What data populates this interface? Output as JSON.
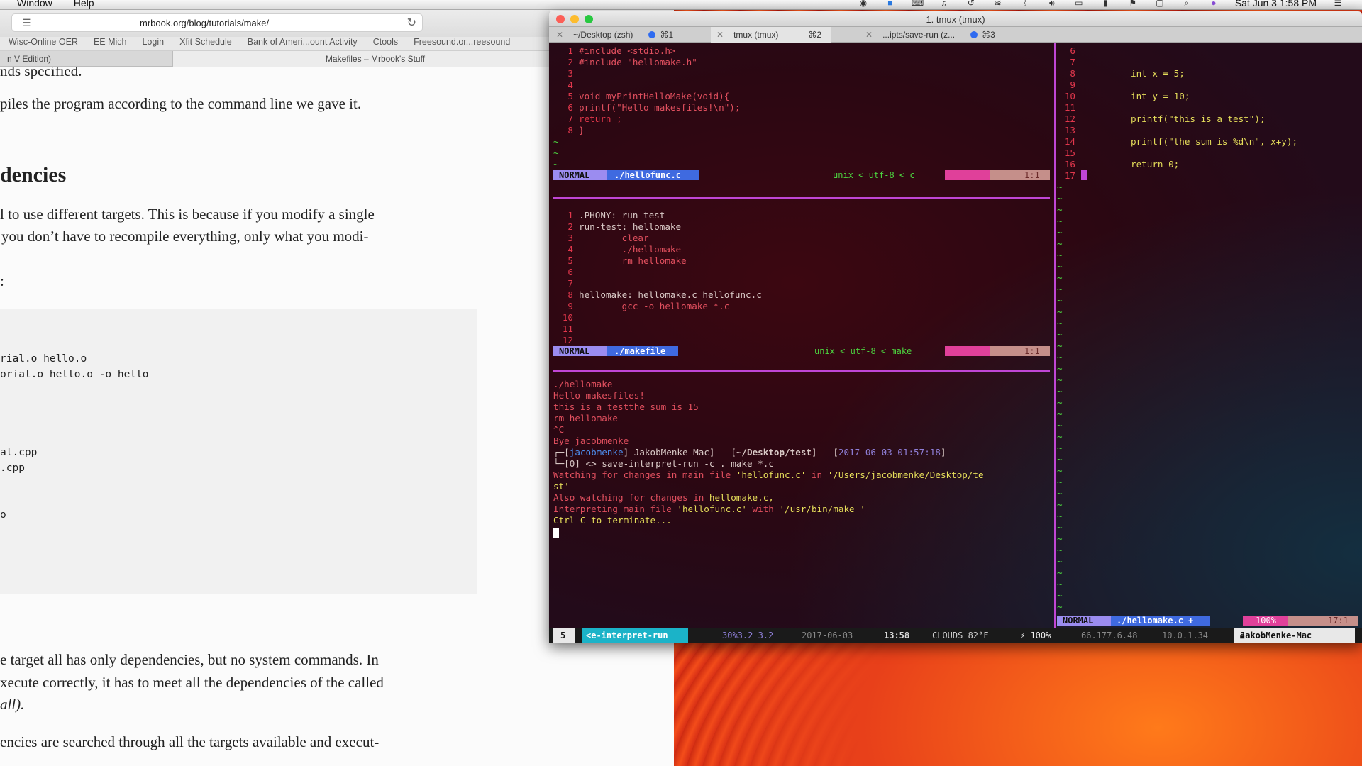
{
  "menubar": {
    "window": "Window",
    "help": "Help",
    "clock": "Sat Jun 3  1:58 PM"
  },
  "browser": {
    "url": "mrbook.org/blog/tutorials/make/",
    "bookmarks": [
      "Wisc-Online OER",
      "EE Mich",
      "Login",
      "Xfit Schedule",
      "Bank of Ameri...ount Activity",
      "Ctools",
      "Freesound.or...reesound"
    ],
    "tab1": "n V Edition)",
    "tab2": "Makefiles – Mrbook's Stuff",
    "article": {
      "line_top": "nds specified.",
      "p1": "piles the program according to the command line we gave it.",
      "heading": "dencies",
      "p2a": "l to use different targets. This is because if you modify a single",
      "p2b": "you don’t have to recompile everything, only what you modi-",
      "colon": ":",
      "code": [
        "rial.o hello.o",
        "orial.o hello.o -o hello",
        "al.cpp",
        ".cpp",
        "o"
      ],
      "p3a": "e target all has only dependencies, but no system commands. In",
      "p3b": "xecute correctly, it has to meet all the dependencies of the called",
      "p3c": "all).",
      "p4": "encies are searched through all the targets available and execut-"
    }
  },
  "terminal": {
    "title": "1. tmux (tmux)",
    "tabs": [
      {
        "label": "~/Desktop (zsh)",
        "shortcut": "⌘1"
      },
      {
        "label": "tmux (tmux)",
        "shortcut": "⌘2"
      },
      {
        "label": "...ipts/save-run (z...",
        "shortcut": "⌘3"
      }
    ],
    "pane1": {
      "lines": [
        {
          "n": "1",
          "t": "#include <stdio.h>"
        },
        {
          "n": "2",
          "t": "#include \"hellomake.h\""
        },
        {
          "n": "3",
          "t": ""
        },
        {
          "n": "4",
          "t": ""
        },
        {
          "n": "5",
          "t": "void myPrintHelloMake(void){"
        },
        {
          "n": "6",
          "t": "printf(\"Hello makesfiles!\\n\");"
        },
        {
          "n": "7",
          "t": "return ;"
        },
        {
          "n": "8",
          "t": "}"
        }
      ],
      "mode": "NORMAL",
      "file": "./hellofunc.c",
      "info": "unix < utf-8 < c",
      "pos": "1:1"
    },
    "pane2": {
      "lines": [
        {
          "n": "1",
          "t": ".PHONY: run-test"
        },
        {
          "n": "2",
          "t": "run-test: hellomake"
        },
        {
          "n": "3",
          "t": "        clear"
        },
        {
          "n": "4",
          "t": "        ./hellomake"
        },
        {
          "n": "5",
          "t": "        rm hellomake"
        },
        {
          "n": "6",
          "t": ""
        },
        {
          "n": "7",
          "t": ""
        },
        {
          "n": "8",
          "t": "hellomake: hellomake.c hellofunc.c"
        },
        {
          "n": "9",
          "t": "        gcc -o hellomake *.c"
        },
        {
          "n": "10",
          "t": ""
        },
        {
          "n": "11",
          "t": ""
        },
        {
          "n": "12",
          "t": ""
        }
      ],
      "mode": "NORMAL",
      "file": "./makefile",
      "info": "unix < utf-8 < make",
      "pos": "1:1"
    },
    "pane3": {
      "lines": [
        "./hellomake",
        "Hello makesfiles!",
        "this is a testthe sum is 15",
        "rm hellomake",
        "^C",
        "Bye jacobmenke"
      ],
      "prompt_user": "jacobmenke",
      "prompt_host": "JakobMenke-Mac",
      "prompt_dir": "~/Desktop/test",
      "prompt_time": "2017-06-03 01:57:18",
      "cmd_prefix": "└─[0] <> ",
      "cmd": "save-interpret-run -c . make *.c",
      "watch1a": "Watching for changes in main file ",
      "watch1b": "'hellofunc.c'",
      "watch1c": " in ",
      "watch1d": "'/Users/jacobmenke/Desktop/te",
      "watch1e": "st'",
      "watch2a": "Also watching for changes in ",
      "watch2b": "hellomake.c,",
      "watch3a": "Interpreting main file ",
      "watch3b": "'hellofunc.c'",
      "watch3c": " with ",
      "watch3d": "'/usr/bin/make '",
      "watch4": "Ctrl-C to terminate..."
    },
    "pane4": {
      "numbers": [
        "6",
        "7",
        "8",
        "9",
        "10",
        "11",
        "12",
        "13",
        "14",
        "15",
        "16",
        "17"
      ],
      "code": [
        {
          "row": 2,
          "t": "int x = 5;"
        },
        {
          "row": 4,
          "t": "int y = 10;"
        },
        {
          "row": 6,
          "t": "printf(\"this is a test\");"
        },
        {
          "row": 8,
          "t": "printf(\"the sum is %d\\n\", x+y);"
        },
        {
          "row": 10,
          "t": "return 0;"
        }
      ],
      "mode": "NORMAL",
      "file": "./hellomake.c +",
      "percent": "100%",
      "pos": "17:1"
    },
    "tmux": {
      "window": "5",
      "name": "<e-interpret-run",
      "load": "30%3.2  3.2",
      "date": "2017-06-03",
      "time": "13:58",
      "weather": "CLOUDS 82°F",
      "battery": "⚡ 100%",
      "ip1": "66.177.6.48",
      "ip2": "10.0.1.34",
      "host": "JakobMenke-Mac"
    }
  },
  "colors": {
    "accent": "#c046d4",
    "vim_mode": "#9b8cf0",
    "vim_file": "#3f6ae0",
    "prompt": "#4cd640"
  }
}
